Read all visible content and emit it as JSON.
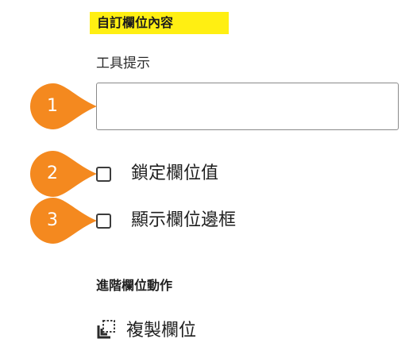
{
  "panel": {
    "section_title": "自訂欄位內容",
    "tooltip_label": "工具提示",
    "tooltip_value": "",
    "lock_label": "鎖定欄位值",
    "show_border_label": "顯示欄位邊框",
    "advanced_title": "進階欄位動作",
    "duplicate_label": "複製欄位"
  },
  "callouts": {
    "one": "1",
    "two": "2",
    "three": "3"
  },
  "colors": {
    "highlight": "#ffef12",
    "callout": "#f4891f"
  },
  "icons": {
    "duplicate": "copy-field-icon",
    "checkbox": "checkbox-icon"
  },
  "state": {
    "lock_checked": false,
    "border_checked": false
  }
}
